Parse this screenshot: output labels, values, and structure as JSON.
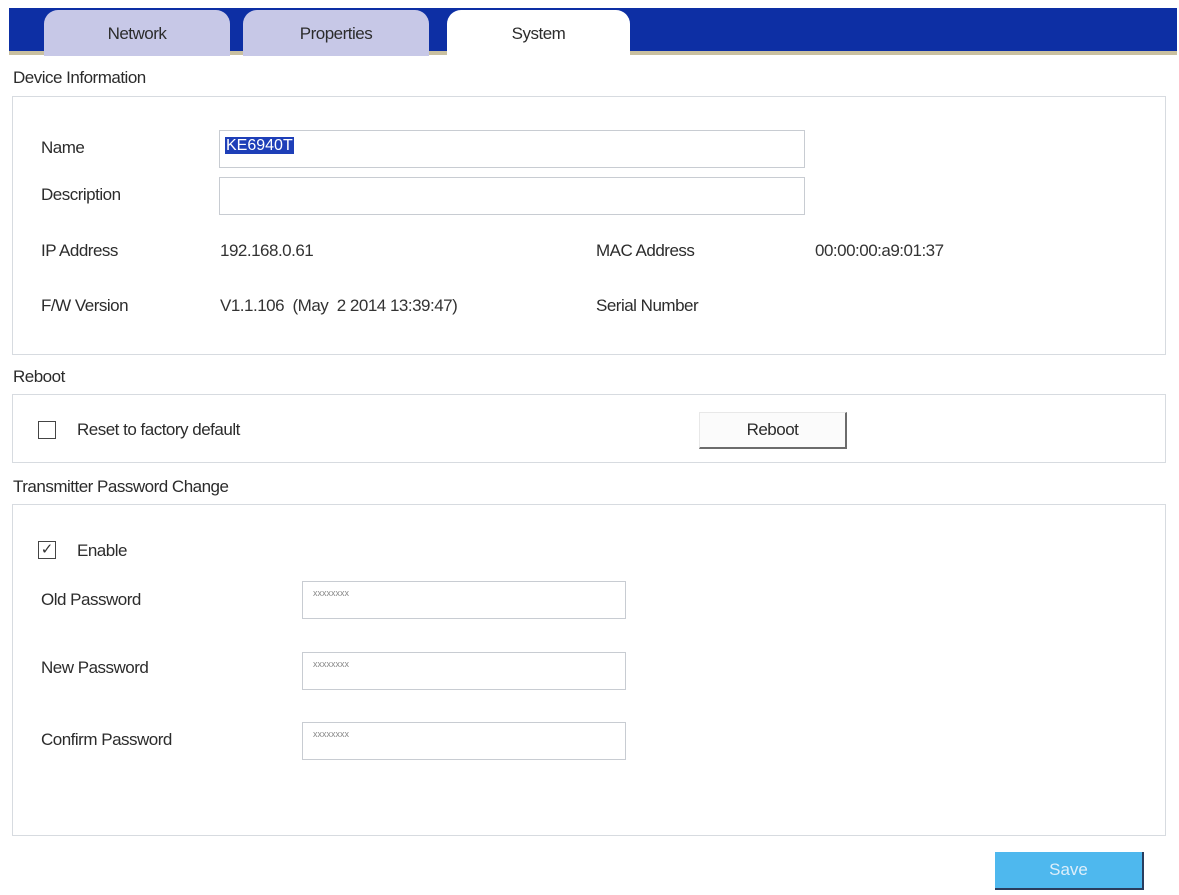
{
  "tabs": [
    {
      "label": "Network",
      "active": false
    },
    {
      "label": "Properties",
      "active": false
    },
    {
      "label": "System",
      "active": true
    }
  ],
  "device_info": {
    "section_title": "Device Information",
    "name_label": "Name",
    "name_value": "KE6940T",
    "description_label": "Description",
    "description_value": "",
    "ip_label": "IP Address",
    "ip_value": "192.168.0.61",
    "mac_label": "MAC Address",
    "mac_value": "00:00:00:a9:01:37",
    "fw_label": "F/W Version",
    "fw_value": "V1.1.106  (May  2 2014 13:39:47)",
    "serial_label": "Serial Number",
    "serial_value": ""
  },
  "reboot": {
    "section_title": "Reboot",
    "reset_label": "Reset to factory default",
    "reset_checked": false,
    "button_label": "Reboot"
  },
  "password_change": {
    "section_title": "Transmitter Password Change",
    "enable_label": "Enable",
    "enable_checked": true,
    "old_label": "Old Password",
    "old_value": "xxxxxxxx",
    "new_label": "New Password",
    "new_value": "xxxxxxxx",
    "confirm_label": "Confirm Password",
    "confirm_value": "xxxxxxxx"
  },
  "save_label": "Save",
  "colors": {
    "tabbar": "#0d2fa4",
    "tab_inactive": "#c7c8e7",
    "selection": "#1e3fb8",
    "save_button": "#4eb8ee"
  }
}
